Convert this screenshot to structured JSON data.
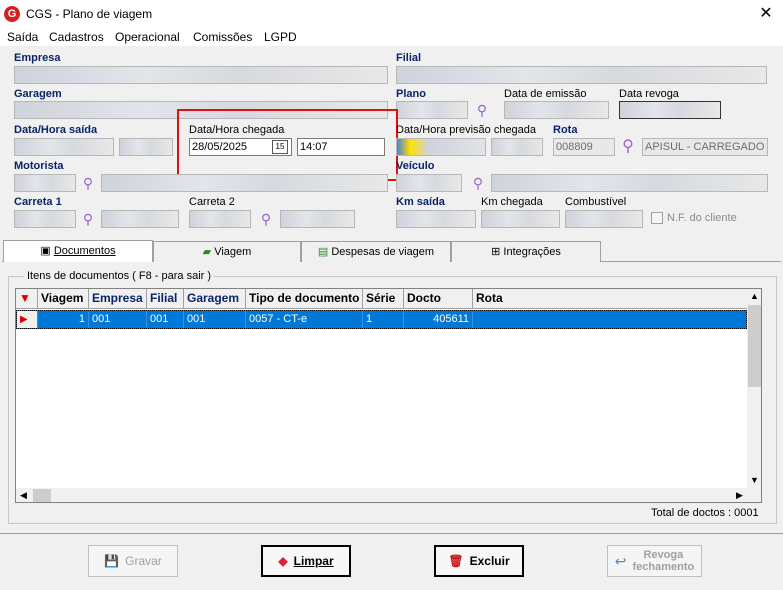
{
  "window": {
    "title": "CGS - Plano de viagem",
    "app_logo": "G"
  },
  "menu": [
    "Saída",
    "Cadastros",
    "Operacional",
    "Comissões",
    "LGPD"
  ],
  "form": {
    "empresa_label": "Empresa",
    "filial_label": "Filial",
    "garagem_label": "Garagem",
    "plano_label": "Plano",
    "data_emissao_label": "Data de emissão",
    "data_revoga_label": "Data revoga",
    "data_hora_saida_label": "Data/Hora saída",
    "data_hora_chegada_label": "Data/Hora chegada",
    "data_chegada_value": "28/05/2025",
    "hora_chegada_value": "14:07",
    "calendar_glyph": "15",
    "previsao_chegada_label": "Data/Hora previsão chegada",
    "rota_label": "Rota",
    "rota_code": "008809",
    "rota_desc": "APISUL - CARREGADO -",
    "motorista_label": "Motorista",
    "veiculo_label": "Veículo",
    "carreta1_label": "Carreta 1",
    "carreta2_label": "Carreta 2",
    "km_saida_label": "Km saída",
    "km_chegada_label": "Km chegada",
    "combustivel_label": "Combustível",
    "nf_cliente_label": "N.F. do cliente"
  },
  "tabs": [
    {
      "label": "Documentos",
      "icon": "documents-icon",
      "active": true
    },
    {
      "label": "Viagem",
      "icon": "truck-icon",
      "active": false
    },
    {
      "label": "Despesas de viagem",
      "icon": "money-icon",
      "active": false
    },
    {
      "label": "Integrações",
      "icon": "integration-icon",
      "active": false
    }
  ],
  "documents": {
    "group_title": "Itens de documentos ( F8 - para sair )",
    "columns": [
      "Viagem",
      "Empresa",
      "Filial",
      "Garagem",
      "Tipo de documento",
      "Série",
      "Docto",
      "Rota"
    ],
    "rows": [
      {
        "viagem": "1",
        "empresa": "001",
        "filial": "001",
        "garagem": "001",
        "tipo": "0057 - CT-e",
        "serie": "1",
        "docto": "405611",
        "rota": ""
      }
    ],
    "total_text": "Total de doctos : 0001"
  },
  "buttons": {
    "gravar": "Gravar",
    "limpar": "Limpar",
    "excluir": "Excluir",
    "revoga_line1": "Revoga",
    "revoga_line2": "fechamento"
  },
  "colors": {
    "selection": "#0078d7",
    "label_blue": "#0a246a",
    "highlight_box": "#e01010"
  }
}
